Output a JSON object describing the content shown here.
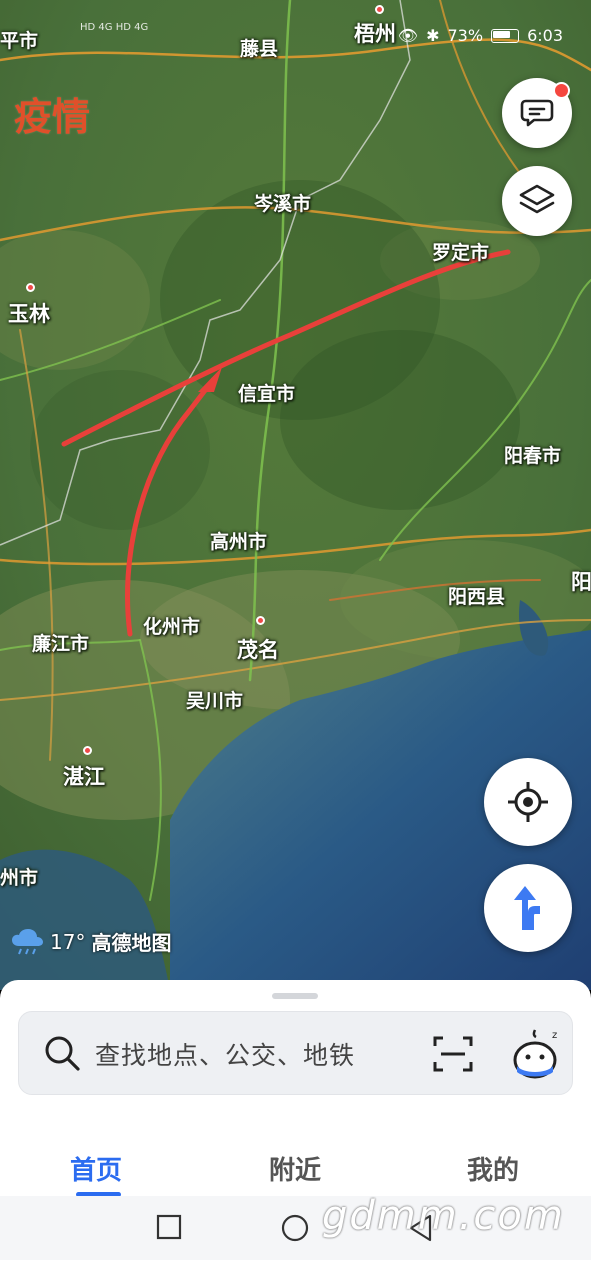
{
  "status_bar": {
    "network_left": "HD 4G HD 4G",
    "battery": "73%",
    "time": "6:03"
  },
  "map": {
    "partial_overlay_text": "疫情",
    "cities": [
      {
        "id": "pingshi",
        "label": "平市"
      },
      {
        "id": "tengxian",
        "label": "藤县"
      },
      {
        "id": "wuzhou",
        "label": "梧州"
      },
      {
        "id": "cenxi",
        "label": "岑溪市"
      },
      {
        "id": "luoding",
        "label": "罗定市"
      },
      {
        "id": "yulin",
        "label": "玉林"
      },
      {
        "id": "xinyi",
        "label": "信宜市"
      },
      {
        "id": "yangchun",
        "label": "阳春市"
      },
      {
        "id": "gaozhou",
        "label": "高州市"
      },
      {
        "id": "yang",
        "label": "阳"
      },
      {
        "id": "yangxi",
        "label": "阳西县"
      },
      {
        "id": "lianjiang",
        "label": "廉江市"
      },
      {
        "id": "huazhou",
        "label": "化州市"
      },
      {
        "id": "maoming",
        "label": "茂名"
      },
      {
        "id": "wuchuan",
        "label": "吴川市"
      },
      {
        "id": "zhanjiang",
        "label": "湛江"
      },
      {
        "id": "zhoushi",
        "label": "州市"
      }
    ],
    "weather": {
      "temperature": "17°",
      "brand": "高德地图"
    },
    "controls": {
      "feedback_icon": "chat-bubble-icon",
      "layers_icon": "layers-icon",
      "locate_icon": "crosshair-icon",
      "navigate_icon": "turn-arrow-icon"
    }
  },
  "bottom_sheet": {
    "search_placeholder": "查找地点、公交、地铁",
    "tabs": [
      {
        "label": "首页",
        "active": true
      },
      {
        "label": "附近",
        "active": false
      },
      {
        "label": "我的",
        "active": false
      }
    ]
  },
  "watermark": "gdmm.com",
  "colors": {
    "accent": "#2b6cf0",
    "route": "#e8403a",
    "badge": "#f5473f"
  }
}
